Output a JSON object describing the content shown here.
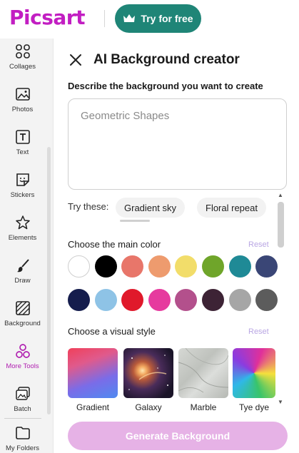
{
  "header": {
    "logo": "Picsart",
    "try_button": "Try for free"
  },
  "sidebar": {
    "items": [
      {
        "label": "Collages",
        "icon": "collages-icon"
      },
      {
        "label": "Photos",
        "icon": "photos-icon"
      },
      {
        "label": "Text",
        "icon": "text-icon"
      },
      {
        "label": "Stickers",
        "icon": "stickers-icon"
      },
      {
        "label": "Elements",
        "icon": "elements-icon"
      },
      {
        "label": "Draw",
        "icon": "draw-icon"
      },
      {
        "label": "Background",
        "icon": "background-icon"
      },
      {
        "label": "More Tools",
        "icon": "more-tools-icon",
        "active": true
      },
      {
        "label": "Batch",
        "icon": "batch-icon"
      },
      {
        "label": "My Folders",
        "icon": "folder-icon"
      }
    ]
  },
  "panel": {
    "title": "AI Background creator",
    "describe_label": "Describe the background you want to create",
    "prompt_placeholder": "Geometric Shapes",
    "try_these_label": "Try these:",
    "suggestions": [
      "Gradient sky",
      "Floral repeat"
    ],
    "color_section_label": "Choose the main color",
    "color_reset": "Reset",
    "colors": [
      "#ffffff",
      "#000000",
      "#e8766a",
      "#ee9b6e",
      "#f2dd6a",
      "#6fa52a",
      "#1f8a96",
      "#3a4676",
      "#151d4d",
      "#8ec3e6",
      "#e0192b",
      "#e63a9e",
      "#b3508c",
      "#3d2335",
      "#a6a6a6",
      "#5c5c5c"
    ],
    "style_section_label": "Choose a visual style",
    "style_reset": "Reset",
    "styles": [
      "Gradient",
      "Galaxy",
      "Marble",
      "Tye dye"
    ],
    "generate_button": "Generate Background"
  }
}
